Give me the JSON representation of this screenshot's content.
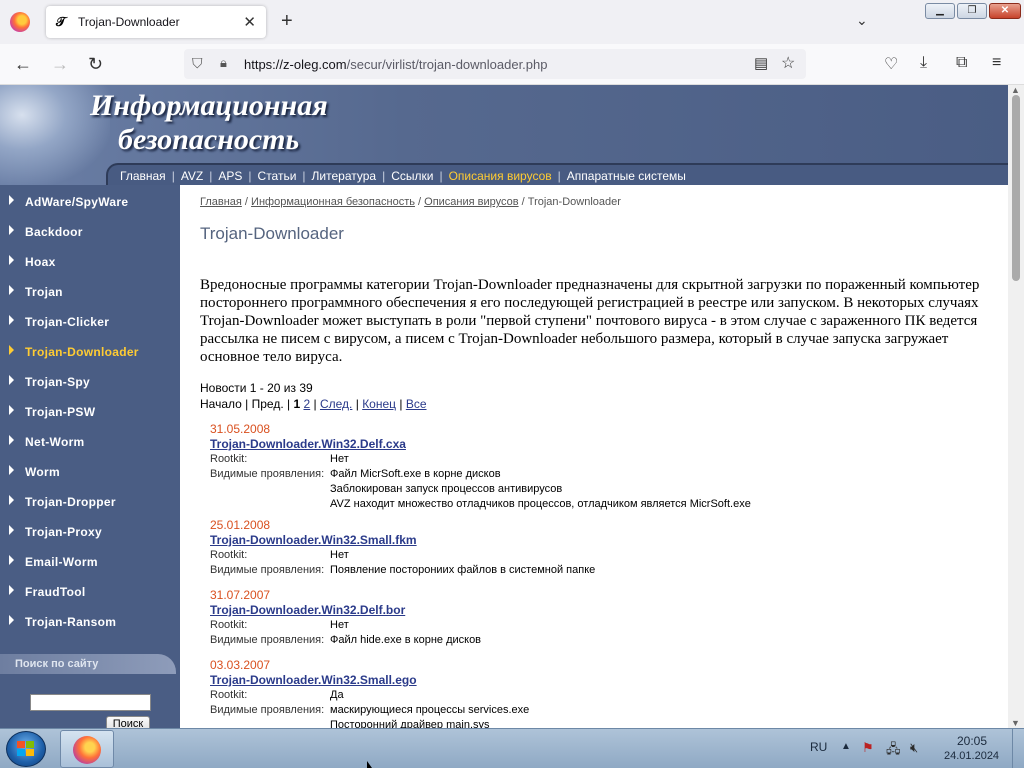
{
  "browser": {
    "tab_title": "Trojan-Downloader",
    "tab_favicon": "𝒯",
    "url_host": "https://z-oleg.com",
    "url_path": "/secur/virlist/trojan-downloader.php",
    "new_tab_symbol": "+",
    "close_symbol": "✕"
  },
  "site": {
    "title_line1": "Информационная",
    "title_line2": "безопасность",
    "topnav": [
      "Главная",
      "AVZ",
      "APS",
      "Статьи",
      "Литература",
      "Ссылки",
      "Описания вирусов",
      "Аппаратные системы"
    ],
    "topnav_active": "Описания вирусов",
    "sidebar": [
      "AdWare/SpyWare",
      "Backdoor",
      "Hoax",
      "Trojan",
      "Trojan-Clicker",
      "Trojan-Downloader",
      "Trojan-Spy",
      "Trojan-PSW",
      "Net-Worm",
      "Worm",
      "Trojan-Dropper",
      "Trojan-Proxy",
      "Email-Worm",
      "FraudTool",
      "Trojan-Ransom"
    ],
    "sidebar_active": "Trojan-Downloader",
    "search_label": "Поиск по сайту",
    "search_button": "Поиск"
  },
  "content": {
    "breadcrumb": [
      "Главная",
      "Информационная безопасность",
      "Описания вирусов"
    ],
    "breadcrumb_current": "Trojan-Downloader",
    "page_title": "Trojan-Downloader",
    "intro": "Вредоносные программы категории Trojan-Downloader предназначены для скрытной загрузки по пораженный компьютер постороннего программного обеспечения я его последующей регистрацией в реестре или запуском. В некоторых случаях Trojan-Downloader может выступать в роли \"первой ступени\" почтового вируса - в этом случае с зараженного ПК ведется рассылка не писем с вирусом, а писем с Trojan-Downloader небольшого размера, который в случае запуска загружает основное тело вируса.",
    "news_count": "Новости 1 - 20 из 39",
    "pager": {
      "start": "Начало",
      "prev": "Пред.",
      "page_current": "1",
      "page_2": "2",
      "next": "След.",
      "end": "Конец",
      "all": "Все"
    },
    "rootkit_label": "Rootkit:",
    "symptoms_label": "Видимые проявления:",
    "entries": [
      {
        "date": "31.05.2008",
        "name": "Trojan-Downloader.Win32.Delf.cxa",
        "rootkit": "Нет",
        "symptoms": [
          "Файл MicrSoft.exe в корне дисков",
          "Заблокирован запуск процессов антивирусов",
          "AVZ находит множество отладчиков процессов, отладчиком является MicrSoft.exe"
        ]
      },
      {
        "date": "25.01.2008",
        "name": "Trojan-Downloader.Win32.Small.fkm",
        "rootkit": "Нет",
        "symptoms": [
          "Появление посторониих файлов в системной папке"
        ]
      },
      {
        "date": "31.07.2007",
        "name": "Trojan-Downloader.Win32.Delf.bor",
        "rootkit": "Нет",
        "symptoms": [
          "Файл hide.exe в корне дисков"
        ]
      },
      {
        "date": "03.03.2007",
        "name": "Trojan-Downloader.Win32.Small.ego",
        "rootkit": "Да",
        "symptoms": [
          "маскирующиеся процессы services.exe",
          "Посторонний драйвер main.sys"
        ]
      }
    ]
  },
  "taskbar": {
    "lang": "RU",
    "time": "20:05",
    "date": "24.01.2024"
  },
  "colors": {
    "header_blue": "#4a5d84",
    "active_yellow": "#ffcc33",
    "date_orange": "#d9501f",
    "link_blue": "#2a3a8a"
  }
}
